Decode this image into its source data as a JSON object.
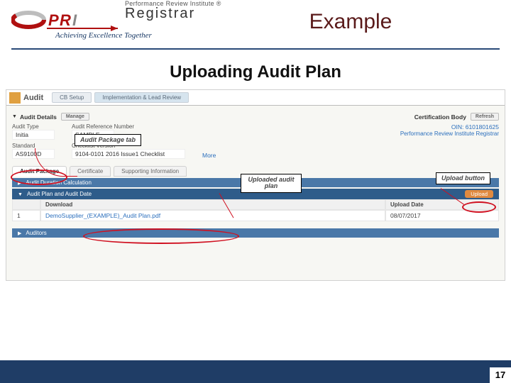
{
  "header": {
    "brand_sub": "Performance Review Institute ®",
    "brand_main": "Registrar",
    "tagline": "Achieving Excellence Together",
    "title": "Example"
  },
  "subtitle": "Uploading Audit Plan",
  "app": {
    "title": "Audit",
    "tabs": [
      "CB Setup",
      "Implementation & Lead Review"
    ]
  },
  "audit_details": {
    "heading": "Audit Details",
    "manage_btn": "Manage",
    "fields": {
      "type_lbl": "Audit Type",
      "type_val": "Initia",
      "ref_lbl": "Audit Reference Number",
      "ref_val": "SAMPLE",
      "std_lbl": "Standard",
      "std_val": "AS9100D",
      "ver_lbl": "Checklist Version",
      "ver_val": "9104-0101 2016 Issue1 Checklist",
      "more": "More"
    }
  },
  "cert_body": {
    "heading": "Certification Body",
    "refresh_btn": "Refresh",
    "oin": "OIN: 6101801625",
    "name": "Performance Review Institute Registrar"
  },
  "sub_tabs": [
    "Audit Package",
    "Certificate",
    "Supporting Information"
  ],
  "sections": {
    "dur": "Audit Duration Calculation",
    "plan": "Audit Plan and Audit Date",
    "auditors": "Auditors"
  },
  "upload_btn": "Upload",
  "table": {
    "col_dl": "Download",
    "col_date": "Upload Date",
    "row_num": "1",
    "row_file": "DemoSupplier_(EXAMPLE)_Audit Plan.pdf",
    "row_date": "08/07/2017"
  },
  "callouts": {
    "pkg_tab": "Audit Package tab",
    "uploaded": "Uploaded audit plan",
    "upl_btn": "Upload button"
  },
  "page_number": "17"
}
